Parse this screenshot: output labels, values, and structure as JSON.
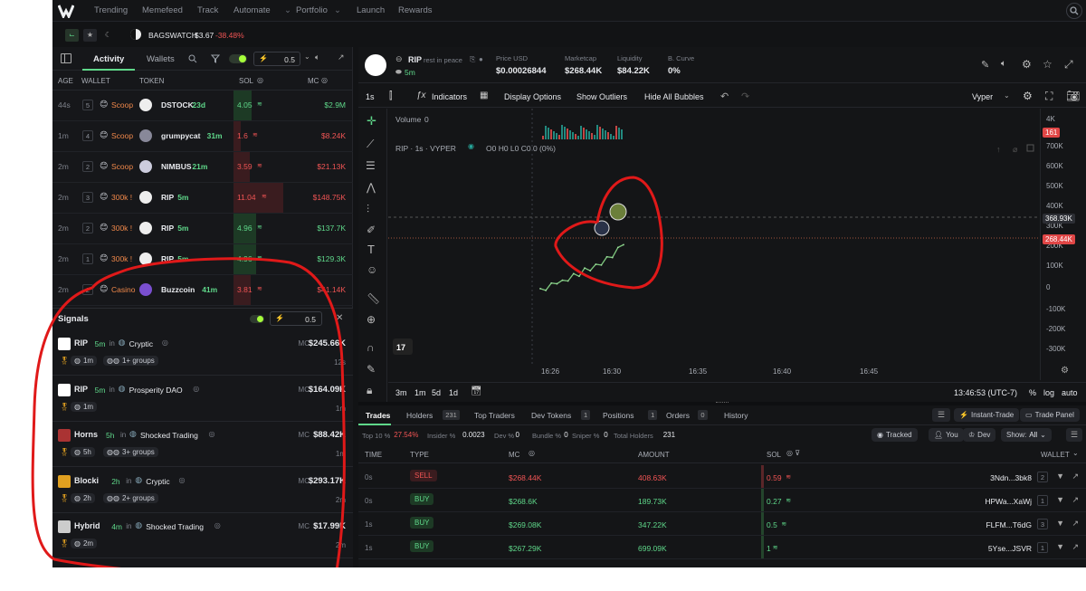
{
  "nav": {
    "items": [
      "Trending",
      "Memefeed",
      "Track",
      "Automate",
      "Portfolio",
      "Launch",
      "Rewards"
    ]
  },
  "ticker": {
    "name": "BAGSWATCH",
    "price": "$3.67",
    "change": "-38.48%"
  },
  "activity": {
    "tab_activity": "Activity",
    "tab_wallets": "Wallets",
    "amount": "0.5",
    "headers": [
      "AGE",
      "WALLET",
      "TOKEN",
      "SOL",
      "MC"
    ],
    "rows": [
      {
        "age": "44s",
        "wallet": "5",
        "label": "Scoop",
        "token": "DSTOCK",
        "tage": "23d",
        "sol": "4.05",
        "mc": "$2.9M",
        "side": "buy"
      },
      {
        "age": "1m",
        "wallet": "4",
        "label": "Scoop",
        "token": "grumpycat",
        "tage": "31m",
        "sol": "1.6",
        "mc": "$8.24K",
        "side": "sell"
      },
      {
        "age": "2m",
        "wallet": "2",
        "label": "Scoop",
        "token": "NIMBUS",
        "tage": "21m",
        "sol": "3.59",
        "mc": "$21.13K",
        "side": "sell"
      },
      {
        "age": "2m",
        "wallet": "3",
        "label": "300k !",
        "token": "RIP",
        "tage": "5m",
        "sol": "11.04",
        "mc": "$148.75K",
        "side": "sell"
      },
      {
        "age": "2m",
        "wallet": "2",
        "label": "300k !",
        "token": "RIP",
        "tage": "5m",
        "sol": "4.96",
        "mc": "$137.7K",
        "side": "buy"
      },
      {
        "age": "2m",
        "wallet": "1",
        "label": "300k !",
        "token": "RIP",
        "tage": "5m",
        "sol": "4.96",
        "mc": "$129.3K",
        "side": "buy"
      },
      {
        "age": "2m",
        "wallet": "2",
        "label": "Casino",
        "token": "Buzzcoin",
        "tage": "41m",
        "sol": "3.81",
        "mc": "$41.14K",
        "side": "sell"
      }
    ]
  },
  "signals": {
    "title": "Signals",
    "amount": "0.5",
    "items": [
      {
        "token": "RIP",
        "age": "5m",
        "in": "in",
        "group": "Cryptic",
        "mc_label": "MC",
        "mc": "$245.66K",
        "t1": "1m",
        "groups": "1+ groups",
        "time": "12s"
      },
      {
        "token": "RIP",
        "age": "5m",
        "in": "in",
        "group": "Prosperity DAO",
        "mc_label": "MC",
        "mc": "$164.09K",
        "t1": "1m",
        "groups": "",
        "time": "1m"
      },
      {
        "token": "Horns",
        "age": "5h",
        "in": "in",
        "group": "Shocked Trading",
        "mc_label": "MC",
        "mc": "$88.42K",
        "t1": "5h",
        "groups": "3+ groups",
        "time": "1m"
      },
      {
        "token": "Blocki",
        "age": "2h",
        "in": "in",
        "group": "Cryptic",
        "mc_label": "MC",
        "mc": "$293.17K",
        "t1": "2h",
        "groups": "2+ groups",
        "time": "2m"
      },
      {
        "token": "Hybrid",
        "age": "4m",
        "in": "in",
        "group": "Shocked Trading",
        "mc_label": "MC",
        "mc": "$17.99K",
        "t1": "2m",
        "groups": "",
        "time": "2m"
      }
    ]
  },
  "token": {
    "name": "RIP",
    "subtitle": "rest in peace",
    "age": "5m",
    "stats": [
      {
        "label": "Price USD",
        "value": "$0.00026844"
      },
      {
        "label": "Marketcap",
        "value": "$268.44K"
      },
      {
        "label": "Liquidity",
        "value": "$84.22K"
      },
      {
        "label": "B. Curve",
        "value": "0%"
      }
    ]
  },
  "toolbar": {
    "interval": "1s",
    "indicators": "Indicators",
    "display": "Display Options",
    "outliers": "Show Outliers",
    "bubbles": "Hide All Bubbles",
    "provider": "Vyper"
  },
  "chart_meta": {
    "volume_label": "Volume",
    "volume_value": "0",
    "legend": "RIP · 1s · VYPER",
    "ohlc": "O0 H0 L0 C0 0 (0%)",
    "yticks": [
      "4K",
      "161",
      "700K",
      "600K",
      "500K",
      "400K",
      "300K",
      "200K",
      "100K",
      "0",
      "-100K",
      "-200K",
      "-300K"
    ],
    "price_tag": "368.93K",
    "current_tag": "268.44K",
    "xticks": [
      "16:26",
      "16:30",
      "16:35",
      "16:40",
      "16:45"
    ],
    "ranges": [
      "3m",
      "1m",
      "5d",
      "1d"
    ],
    "clock": "13:46:53 (UTC-7)",
    "pct": "%",
    "log": "log",
    "auto": "auto"
  },
  "chart_data": {
    "type": "line",
    "title": "RIP · 1s · VYPER",
    "x": [
      0,
      1,
      2,
      3,
      4,
      5,
      6,
      7,
      8,
      9,
      10,
      11,
      12,
      13,
      14,
      15
    ],
    "series": [
      {
        "values": [
          10,
          25,
          40,
          60,
          55,
          75,
          90,
          100,
          120,
          130,
          140,
          160,
          180,
          200,
          230,
          268.44
        ]
      }
    ],
    "ylabel": "",
    "ylim": [
      -300,
      700
    ]
  },
  "trades": {
    "tabs": [
      {
        "label": "Trades",
        "count": ""
      },
      {
        "label": "Holders",
        "count": "231"
      },
      {
        "label": "Top Traders",
        "count": ""
      },
      {
        "label": "Dev Tokens",
        "count": "1"
      },
      {
        "label": "Positions",
        "count": "1"
      },
      {
        "label": "Orders",
        "count": "0"
      },
      {
        "label": "History",
        "count": ""
      }
    ],
    "instant": "Instant-Trade",
    "panel": "Trade Panel",
    "stats": [
      {
        "label": "Top 10 %",
        "value": "27.54%"
      },
      {
        "label": "Insider %",
        "value": "0.0023"
      },
      {
        "label": "Dev %",
        "value": "0"
      },
      {
        "label": "Bundle %",
        "value": "0"
      },
      {
        "label": "Sniper %",
        "value": "0"
      },
      {
        "label": "Total Holders",
        "value": "231"
      }
    ],
    "filters": {
      "tracked": "Tracked",
      "you": "You",
      "dev": "Dev",
      "show": "Show:",
      "all": "All"
    },
    "headers": [
      "TIME",
      "TYPE",
      "MC",
      "AMOUNT",
      "SOL",
      "WALLET"
    ],
    "rows": [
      {
        "time": "0s",
        "type": "SELL",
        "mc": "$268.44K",
        "amount": "408.63K",
        "sol": "0.59",
        "wallet": "3Ndn...3bk8",
        "n": "2"
      },
      {
        "time": "0s",
        "type": "BUY",
        "mc": "$268.6K",
        "amount": "189.73K",
        "sol": "0.27",
        "wallet": "HPWa...XaWj",
        "n": "1"
      },
      {
        "time": "1s",
        "type": "BUY",
        "mc": "$269.08K",
        "amount": "347.22K",
        "sol": "0.5",
        "wallet": "FLFM...T6dG",
        "n": "3"
      },
      {
        "time": "1s",
        "type": "BUY",
        "mc": "$267.29K",
        "amount": "699.09K",
        "sol": "1",
        "wallet": "5Yse...JSVR",
        "n": "1"
      }
    ]
  }
}
